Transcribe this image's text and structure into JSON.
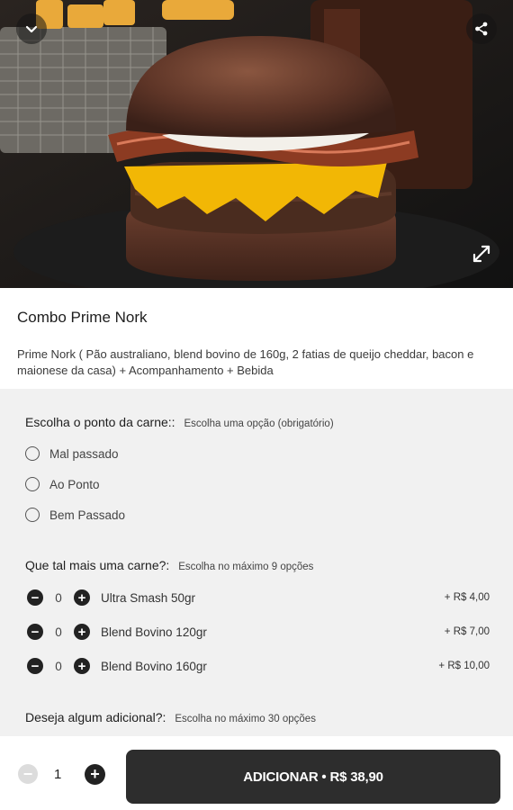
{
  "product": {
    "title": "Combo Prime Nork",
    "description": "Prime Nork ( Pão australiano, blend bovino de 160g, 2 fatias de queijo cheddar, bacon e maionese da casa) + Acompanhamento + Bebida"
  },
  "hero": {
    "back_icon": "chevron-down-icon",
    "share_icon": "share-icon",
    "expand_icon": "expand-icon"
  },
  "sections": {
    "meat_point": {
      "title": "Escolha o ponto da carne::",
      "hint": "Escolha uma opção (obrigatório)",
      "options": [
        "Mal passado",
        "Ao Ponto",
        "Bem Passado"
      ]
    },
    "extra_meat": {
      "title": "Que tal mais uma carne?:",
      "hint": "Escolha no máximo 9 opções",
      "items": [
        {
          "qty": "0",
          "name": "Ultra Smash 50gr",
          "price": "+ R$ 4,00"
        },
        {
          "qty": "0",
          "name": "Blend Bovino 120gr",
          "price": "+ R$ 7,00"
        },
        {
          "qty": "0",
          "name": "Blend Bovino 160gr",
          "price": "+ R$ 10,00"
        }
      ]
    },
    "additional": {
      "title": "Deseja algum adicional?:",
      "hint": "Escolha no máximo 30 opções"
    }
  },
  "footer": {
    "quantity": "1",
    "add_label": "ADICIONAR • R$ 38,90"
  },
  "colors": {
    "dark_button": "#2d2d2d",
    "section_bg": "#f1f1f1",
    "cheese": "#f2b705",
    "bun": "#5a3426"
  }
}
